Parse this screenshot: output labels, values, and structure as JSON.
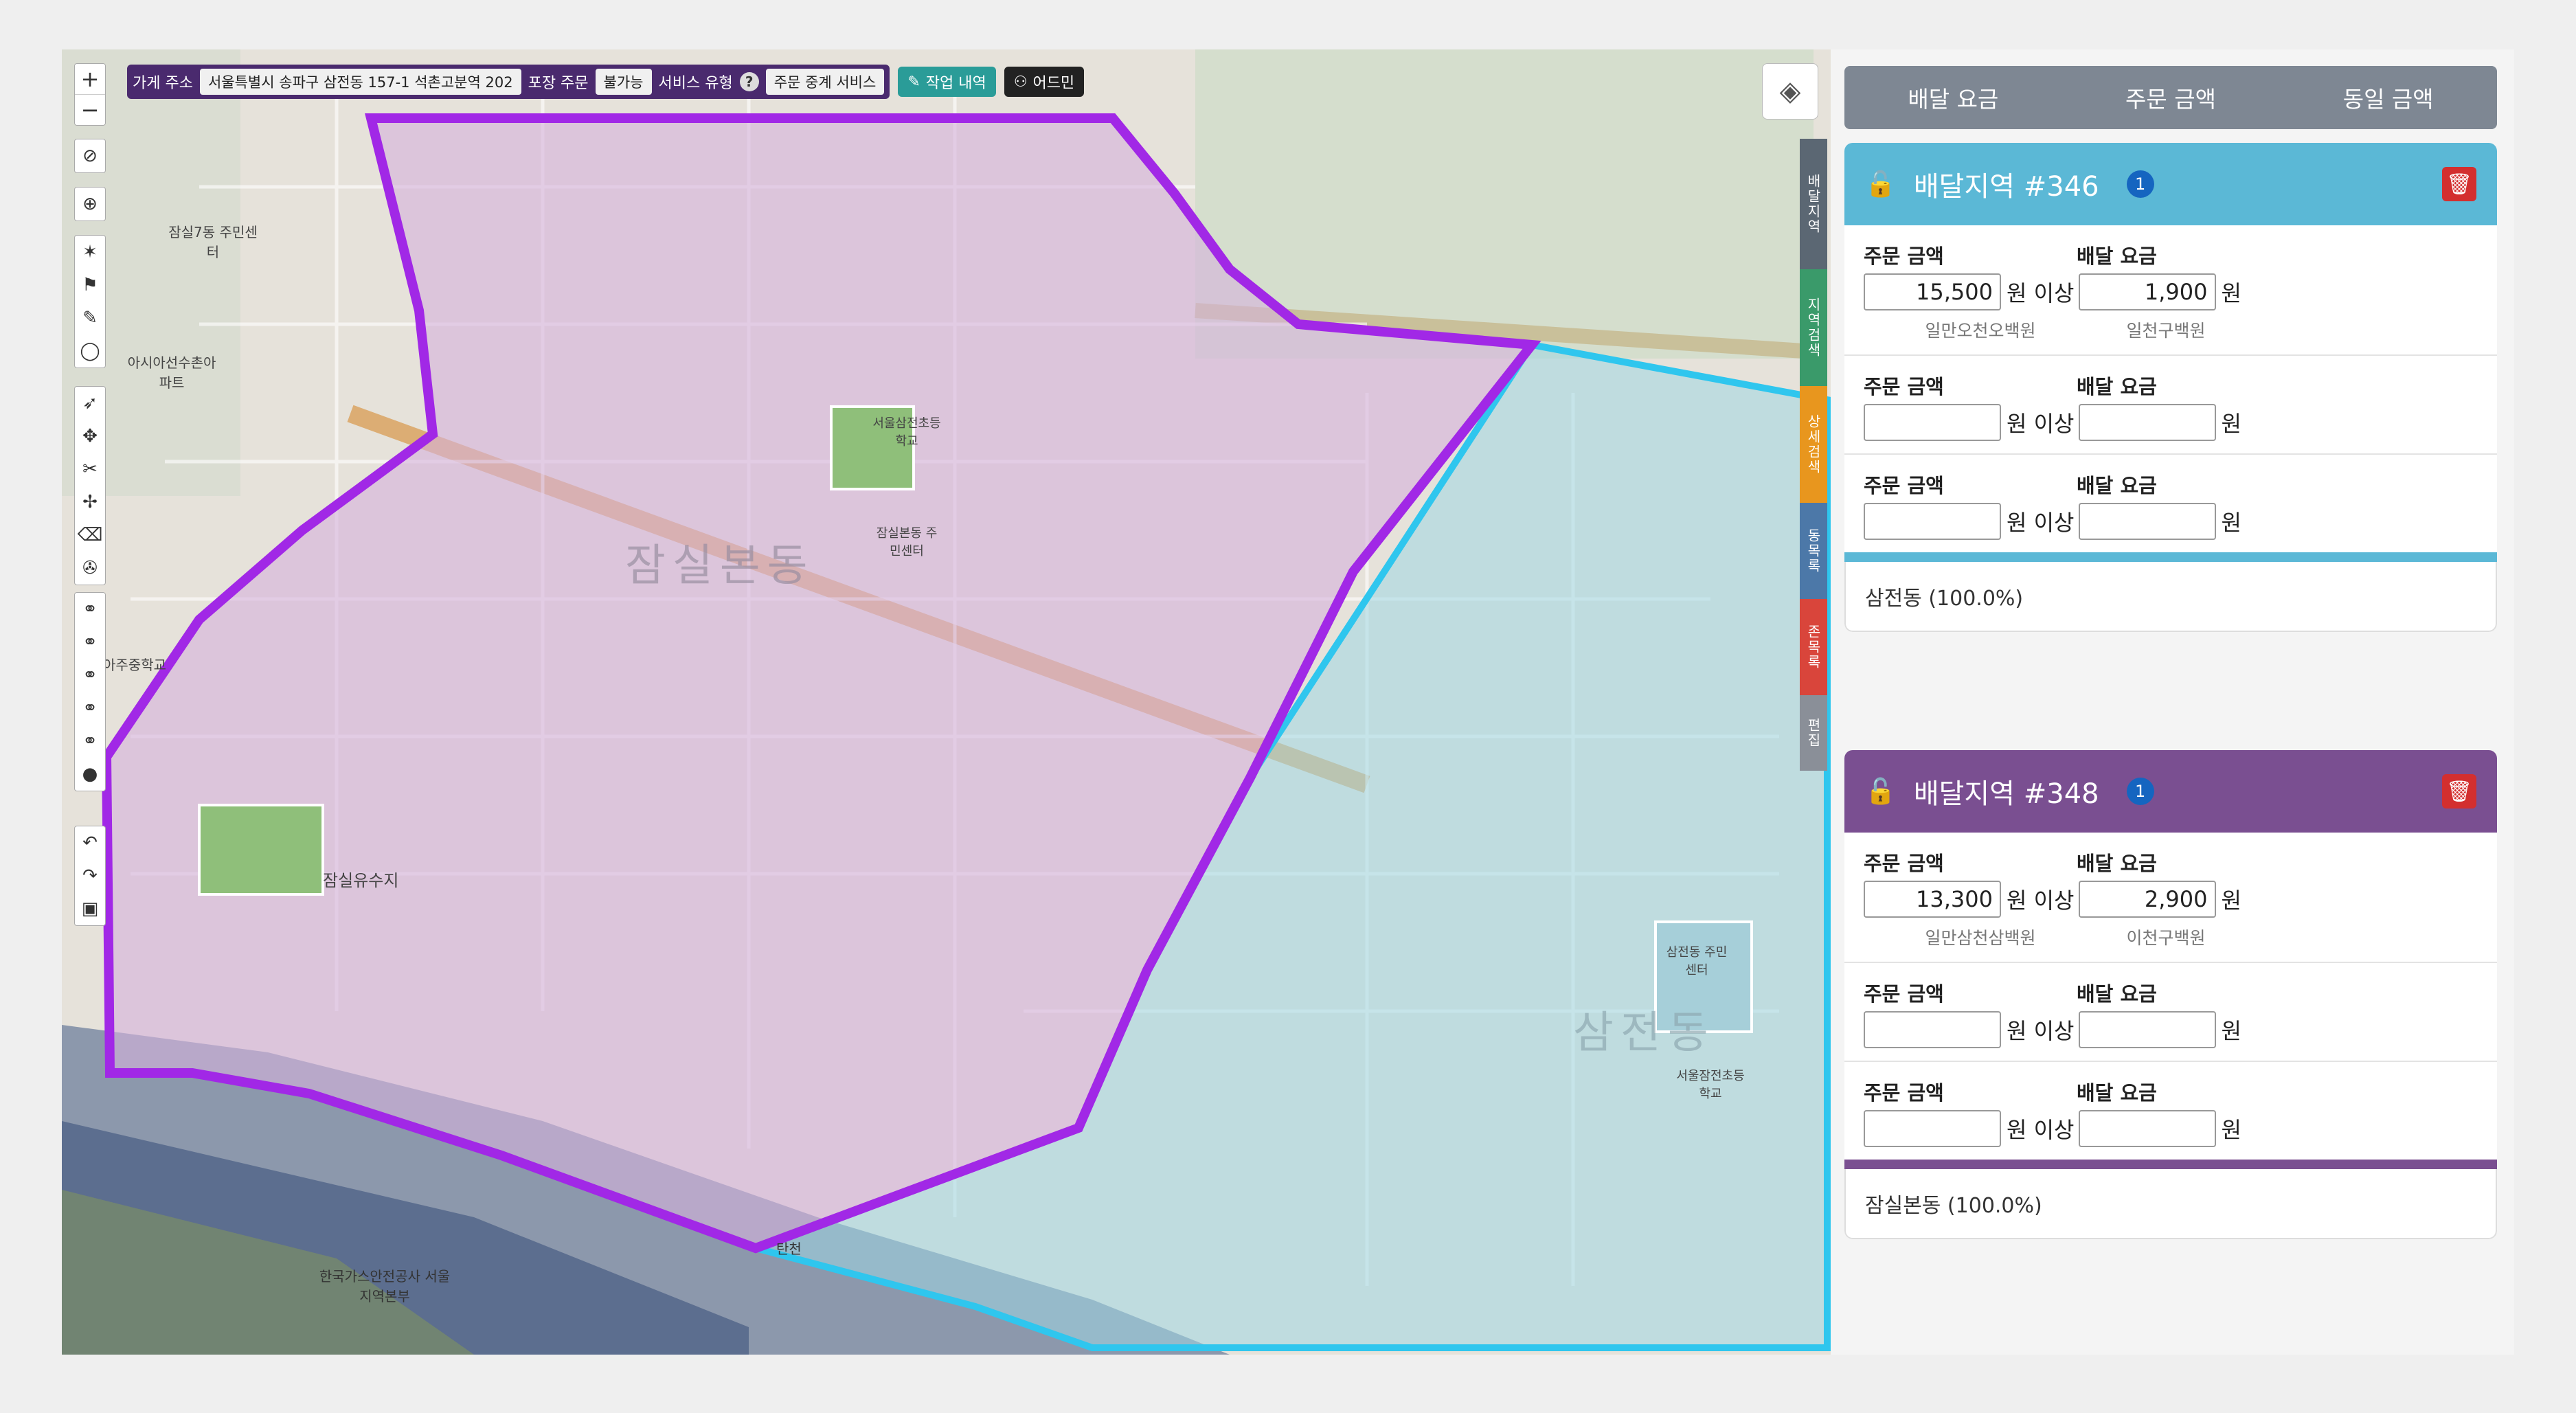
{
  "toolbar": {
    "store_address_label": "가게 주소",
    "store_address_value": "서울특별시 송파구 삼전동 157-1 석촌고분역 202",
    "pickup_label": "포장 주문",
    "pickup_value": "불가능",
    "service_type_label": "서비스 유형",
    "service_type_help": "?",
    "order_relay_label": "주문 중계 서비스",
    "work_history_button": "작업 내역",
    "admin_button": "어드민"
  },
  "map": {
    "zoom_in": "+",
    "zoom_out": "−",
    "side_tabs": [
      {
        "label": "배달지역",
        "color": "#5b6773"
      },
      {
        "label": "지역검색",
        "color": "#3a9a6a"
      },
      {
        "label": "상세검색",
        "color": "#e8961e"
      },
      {
        "label": "동목록",
        "color": "#4c78a8"
      },
      {
        "label": "존목록",
        "color": "#d9453b"
      },
      {
        "label": "편집",
        "color": "#8a8f98"
      }
    ],
    "labels": [
      {
        "text": "잠실본동",
        "large": true
      },
      {
        "text": "삼전동",
        "large": true
      },
      {
        "text": "잠실7동 주민센터"
      },
      {
        "text": "아시아선수촌아파트"
      },
      {
        "text": "아주중학교"
      },
      {
        "text": "잠실유수지"
      },
      {
        "text": "한국가스안전공사 서울지역본부"
      },
      {
        "text": "서울삼전초등학교"
      },
      {
        "text": "삼전동 주민센터"
      },
      {
        "text": "서울잠전초등학교"
      },
      {
        "text": "잠실본동 주민센터"
      },
      {
        "text": "탄천"
      }
    ]
  },
  "panel": {
    "tabs": [
      "배달 요금",
      "주문 금액",
      "동일 금액"
    ],
    "cards": [
      {
        "title": "배달지역 #346",
        "badge": "1",
        "color": "#5bb8d6",
        "rows": [
          {
            "order_label": "주문 금액",
            "fee_label": "배달 요금",
            "order_value": "15,500",
            "fee_value": "1,900",
            "above": "원 이상",
            "won": "원",
            "order_hint": "일만오천오백원",
            "fee_hint": "일천구백원"
          },
          {
            "order_label": "주문 금액",
            "fee_label": "배달 요금",
            "order_value": "",
            "fee_value": "",
            "above": "원 이상",
            "won": "원"
          },
          {
            "order_label": "주문 금액",
            "fee_label": "배달 요금",
            "order_value": "",
            "fee_value": "",
            "above": "원 이상",
            "won": "원"
          }
        ],
        "footer": "삼전동 (100.0%)"
      },
      {
        "title": "배달지역 #348",
        "badge": "1",
        "color": "#7a4f91",
        "rows": [
          {
            "order_label": "주문 금액",
            "fee_label": "배달 요금",
            "order_value": "13,300",
            "fee_value": "2,900",
            "above": "원 이상",
            "won": "원",
            "order_hint": "일만삼천삼백원",
            "fee_hint": "이천구백원"
          },
          {
            "order_label": "주문 금액",
            "fee_label": "배달 요금",
            "order_value": "",
            "fee_value": "",
            "above": "원 이상",
            "won": "원"
          },
          {
            "order_label": "주문 금액",
            "fee_label": "배달 요금",
            "order_value": "",
            "fee_value": "",
            "above": "원 이상",
            "won": "원"
          }
        ],
        "footer": "잠실본동 (100.0%)"
      }
    ]
  }
}
